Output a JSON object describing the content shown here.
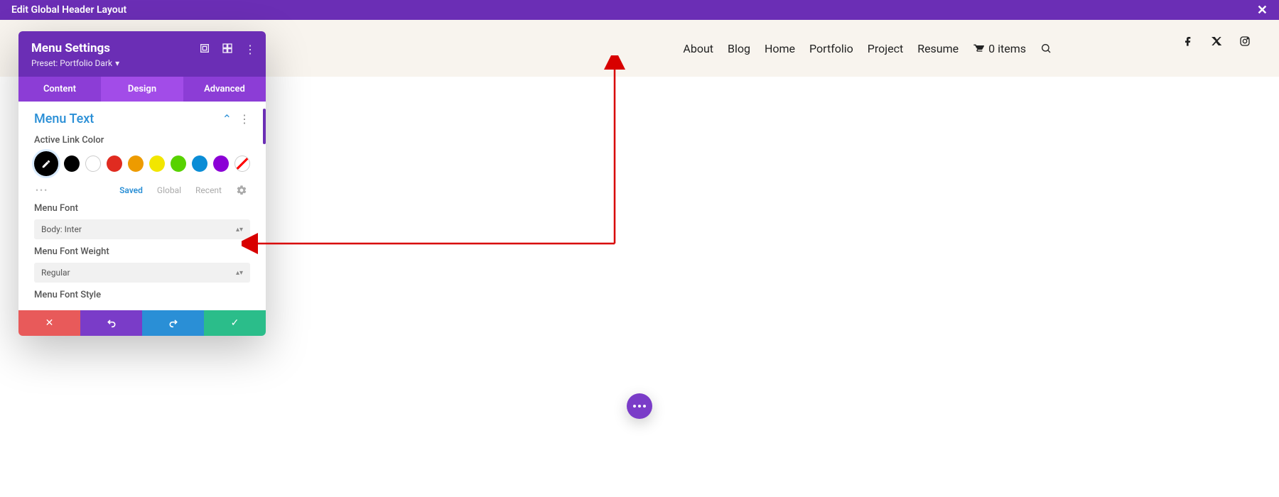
{
  "topbar": {
    "title": "Edit Global Header Layout"
  },
  "header": {
    "nav": [
      "About",
      "Blog",
      "Home",
      "Portfolio",
      "Project",
      "Resume"
    ],
    "cart_text": "0 items"
  },
  "panel": {
    "title": "Menu Settings",
    "preset_label": "Preset: Portfolio Dark",
    "tabs": {
      "content": "Content",
      "design": "Design",
      "advanced": "Advanced"
    },
    "section_title": "Menu Text",
    "active_link_color_label": "Active Link Color",
    "swatches": [
      "#000000",
      "#000000",
      "#ffffff",
      "#e02b20",
      "#ed9b00",
      "#f2e600",
      "#58d200",
      "#0b8dd6",
      "#8b00d6",
      "none"
    ],
    "palette_tabs": {
      "saved": "Saved",
      "global": "Global",
      "recent": "Recent"
    },
    "menu_font_label": "Menu Font",
    "menu_font_value": "Body: Inter",
    "menu_font_weight_label": "Menu Font Weight",
    "menu_font_weight_value": "Regular",
    "menu_font_style_label": "Menu Font Style"
  }
}
